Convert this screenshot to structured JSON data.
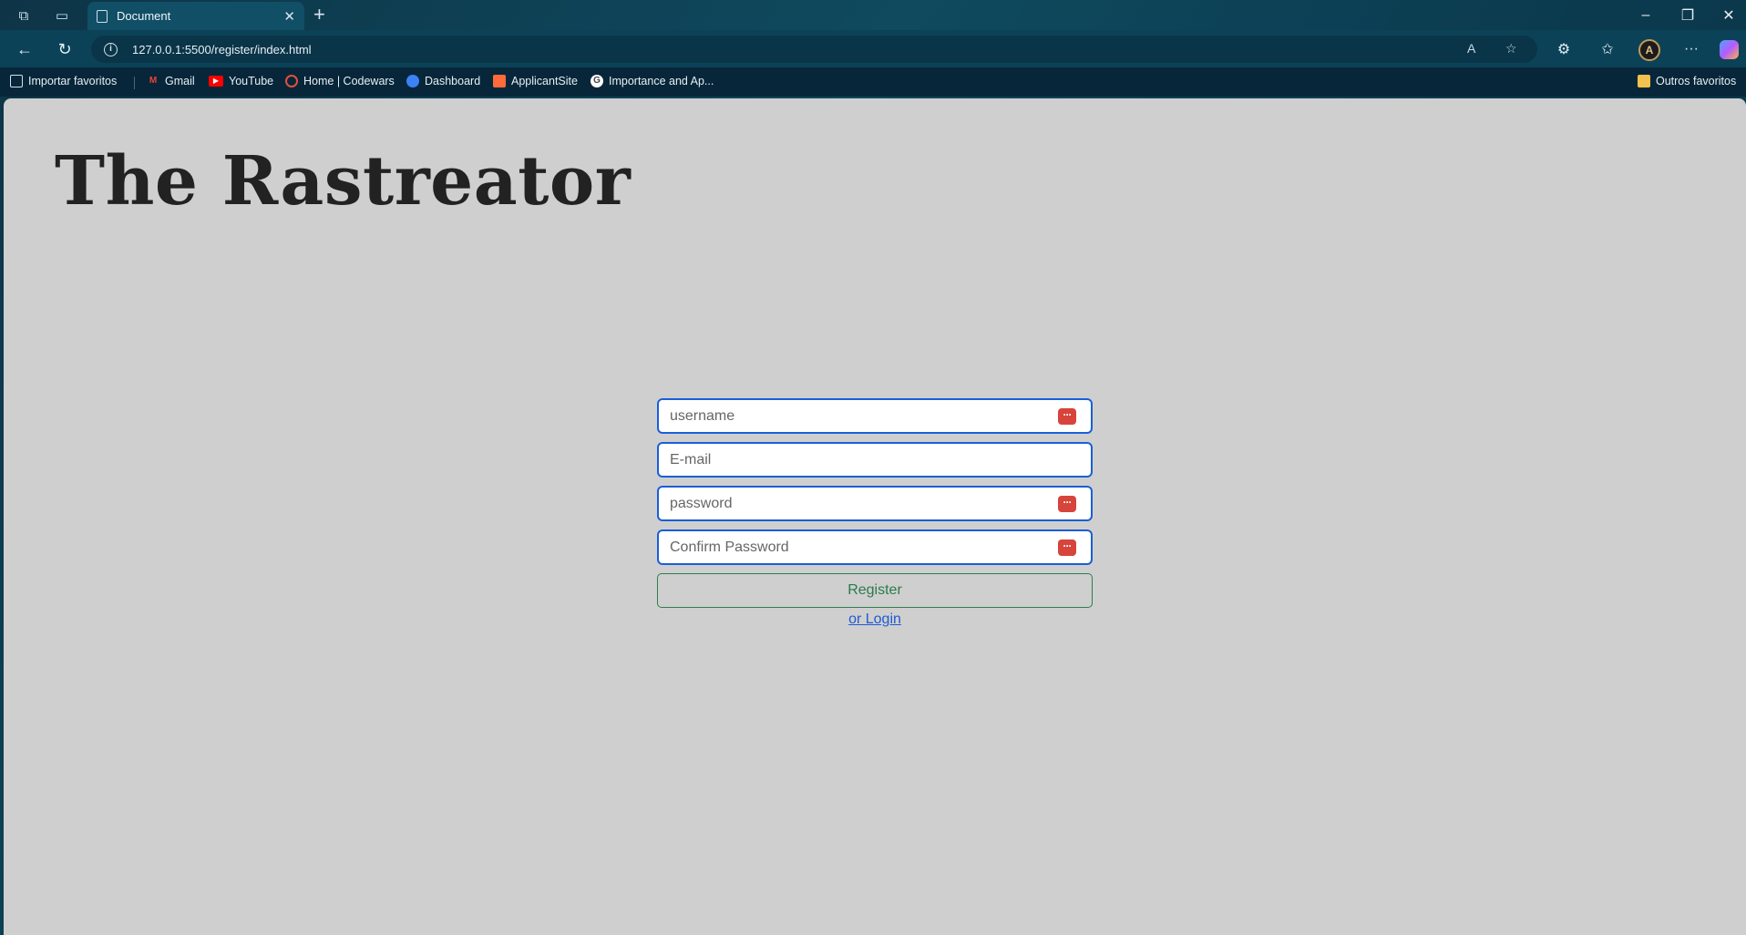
{
  "browser": {
    "tab": {
      "title": "Document"
    },
    "url": "127.0.0.1:5500/register/index.html",
    "bookmarks": [
      {
        "label": "Importar favoritos",
        "icon": "import-icon"
      },
      {
        "label": "Gmail",
        "icon": "gmail-icon"
      },
      {
        "label": "YouTube",
        "icon": "youtube-icon"
      },
      {
        "label": "Home | Codewars",
        "icon": "codewars-icon"
      },
      {
        "label": "Dashboard",
        "icon": "dashboard-icon"
      },
      {
        "label": "ApplicantSite",
        "icon": "applicantsite-icon"
      },
      {
        "label": "Importance and Ap...",
        "icon": "google-icon"
      }
    ],
    "other_favorites": "Outros favoritos"
  },
  "page": {
    "title": "The Rastreator",
    "form": {
      "username_placeholder": "username",
      "email_placeholder": "E-mail",
      "password_placeholder": "password",
      "confirm_placeholder": "Confirm Password",
      "register_label": "Register",
      "login_link": "or Login"
    }
  },
  "colors": {
    "page_bg": "#cfcfcf",
    "input_border": "#1a5fd6",
    "register_text": "#2b7a4b",
    "link": "#1f5bd1",
    "password_key": "#d7443b"
  }
}
